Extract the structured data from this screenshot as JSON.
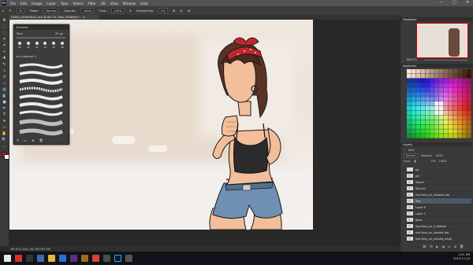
{
  "menubar": {
    "app_logo": "Ps",
    "items": [
      "File",
      "Edit",
      "Image",
      "Layer",
      "Type",
      "Select",
      "Filter",
      "3D",
      "View",
      "Window",
      "Help"
    ],
    "window_controls": [
      "—",
      "▢",
      "✕"
    ]
  },
  "options_bar": {
    "size": "25",
    "mode_label": "Mode:",
    "mode_value": "Normal",
    "opacity_label": "Opacity:",
    "opacity_value": "100%",
    "flow_label": "Flow:",
    "flow_value": "100%",
    "smoothing_label": "Smoothing:",
    "smoothing_value": "0%"
  },
  "document_tab": {
    "label": "DVARI_SHAVENG2.psd @ 66.7% (Tres, RGB/8#) *",
    "close": "×"
  },
  "brush_panel": {
    "title": "Brushes",
    "size_label": "Size:",
    "size_value": "25 px",
    "preset_sizes": [
      "30",
      "30",
      "30",
      "25",
      "25",
      "50"
    ],
    "group_name": "Inkbrush 1"
  },
  "status_bar": {
    "text": "66.67%    Doc: 64.2M/765.6M"
  },
  "right_panels": {
    "navigator_title": "Navigator",
    "zoom_value": "66.67%",
    "swatches_title": "Swatches",
    "layers_title": "Layers",
    "search_label": "Kind",
    "blend_value": "Normal",
    "opacity_label": "Opacity:",
    "opacity_value": "100%",
    "lock_label": "Lock:",
    "fill_label": "Fill:",
    "fill_value": "100%",
    "layers": [
      {
        "name": "bg",
        "visible": false
      },
      {
        "name": "girl",
        "visible": true
      },
      {
        "name": "Sketch",
        "visible": true
      },
      {
        "name": "Shoved",
        "visible": true
      },
      {
        "name": "marlhary_on_showed_top",
        "visible": true
      },
      {
        "name": "Trac",
        "visible": true
      },
      {
        "name": "Layer 6",
        "visible": true
      },
      {
        "name": "Layer 7",
        "visible": true
      },
      {
        "name": "Base",
        "visible": true
      },
      {
        "name": "marlhary_on_d_bottom",
        "visible": true
      },
      {
        "name": "marlhary_on_shaved_top",
        "visible": true
      },
      {
        "name": "marlhary_on_shaved_white",
        "visible": true
      }
    ]
  },
  "taskbar": {
    "time": "3:51 PM",
    "date": "2019-11-20"
  },
  "colors": {
    "foreground": "#e01010",
    "background": "#ffffff",
    "accent": "#31a8ff"
  }
}
